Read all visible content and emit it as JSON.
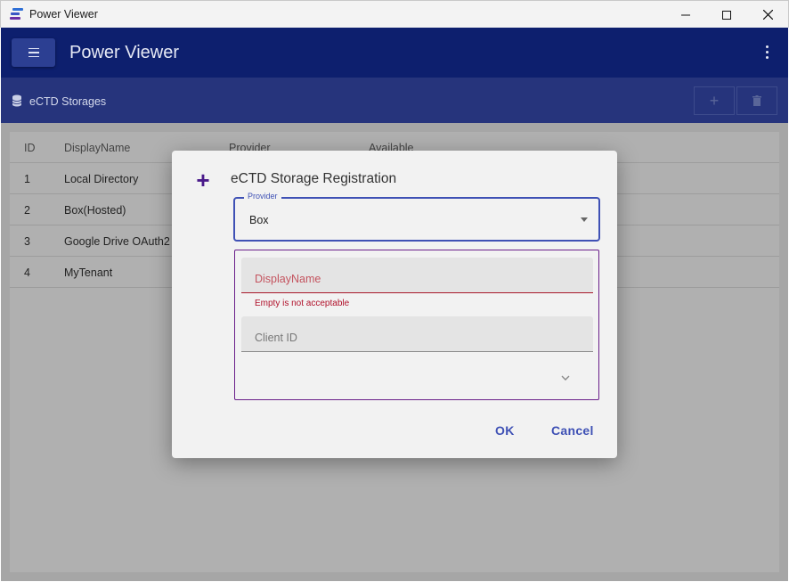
{
  "window": {
    "title": "Power Viewer",
    "minimize_icon": "minimize-icon",
    "maximize_icon": "maximize-icon",
    "close_icon": "close-icon"
  },
  "appbar": {
    "title": "Power Viewer",
    "menu_icon": "hamburger-icon",
    "more_icon": "more-vertical-icon",
    "color": "#0d1f6e"
  },
  "subbar": {
    "label": "eCTD Storages",
    "icon": "database-icon",
    "add_icon": "+",
    "delete_icon": "trash-icon"
  },
  "table": {
    "headers": [
      "ID",
      "DisplayName",
      "Provider",
      "Available"
    ],
    "rows": [
      {
        "id": "1",
        "name": "Local Directory"
      },
      {
        "id": "2",
        "name": "Box(Hosted)"
      },
      {
        "id": "3",
        "name": "Google Drive OAuth2"
      },
      {
        "id": "4",
        "name": "MyTenant"
      }
    ]
  },
  "dialog": {
    "title": "eCTD Storage Registration",
    "plus_icon": "+",
    "provider": {
      "legend": "Provider",
      "value": "Box"
    },
    "display_name": {
      "label": "DisplayName",
      "error": "Empty is not acceptable"
    },
    "client_id": {
      "label": "Client ID"
    },
    "ok_label": "OK",
    "cancel_label": "Cancel",
    "accent": "#3f51b5",
    "error_color": "#b0102a"
  }
}
